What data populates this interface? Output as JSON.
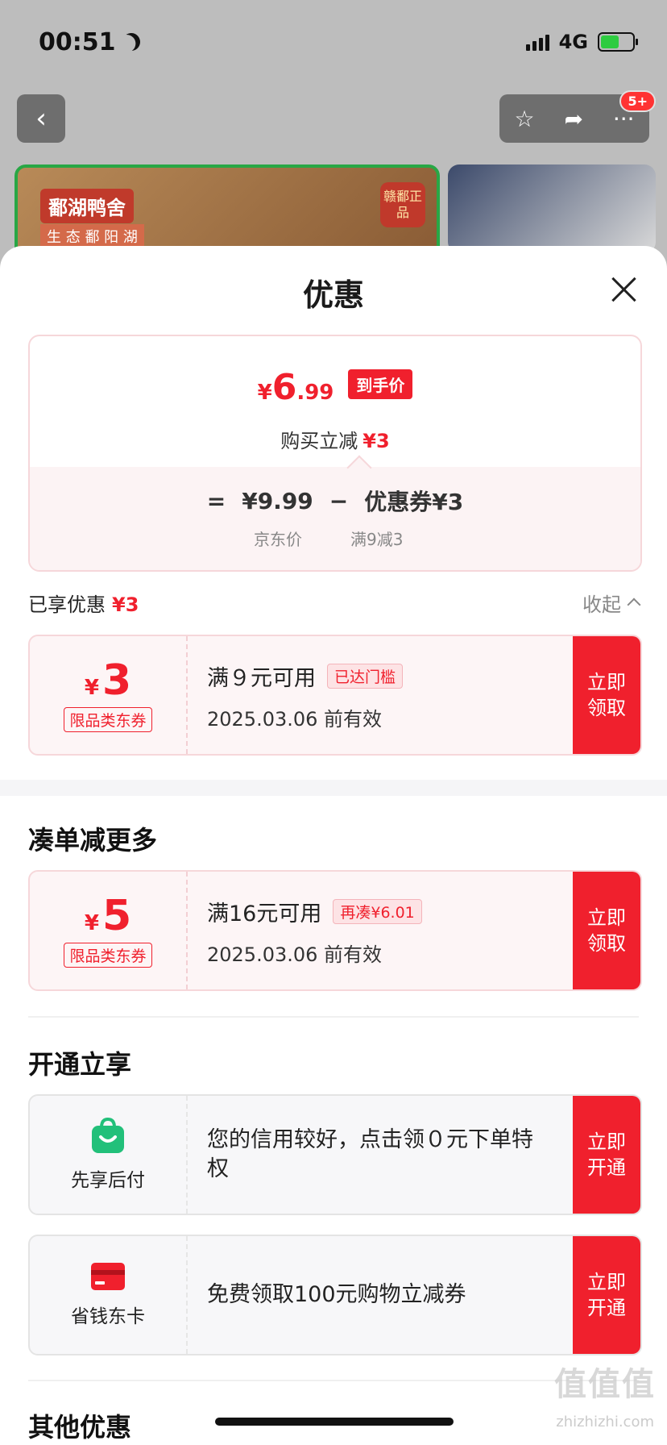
{
  "status": {
    "time": "00:51",
    "network": "4G"
  },
  "background": {
    "badge": "5+",
    "brand": "鄱湖鸭舍",
    "brand_sub": "生 态 鄱 阳 湖",
    "seal": "赣鄱正品"
  },
  "sheet": {
    "title": "优惠",
    "price_card": {
      "final_yen": "¥",
      "final_int": "6",
      "final_dec": ".99",
      "final_tag": "到手价",
      "reduce_label": "购买立减",
      "reduce_value": "¥3",
      "calc_eq": "=",
      "calc_price": "¥9.99",
      "calc_minus": "−",
      "calc_coupon": "优惠券¥3",
      "price_label": "京东价",
      "coupon_rule": "满9减3"
    },
    "enjoyed": {
      "label": "已享优惠",
      "value": "¥3",
      "collapse": "收起"
    },
    "coupons": [
      {
        "yen": "¥",
        "amount": "3",
        "type": "限品类东券",
        "condition": "满９元可用",
        "tag": "已达门槛",
        "date": "2025.03.06 前有效",
        "button": "立即\n领取"
      }
    ],
    "more_section_title": "凑单减更多",
    "more_coupons": [
      {
        "yen": "¥",
        "amount": "5",
        "type": "限品类东券",
        "condition": "满16元可用",
        "tag": "再凑¥6.01",
        "date": "2025.03.06 前有效",
        "button": "立即\n领取"
      }
    ],
    "open_section_title": "开通立享",
    "services": [
      {
        "icon": "shopping-bag-icon",
        "name": "先享后付",
        "text": "您的信用较好，点击领０元下单特权",
        "button": "立即\n开通",
        "color": "#22c07a"
      },
      {
        "icon": "card-icon",
        "name": "省钱东卡",
        "text": "免费领取100元购物立减券",
        "button": "立即\n开通",
        "color": "#f0202d"
      }
    ],
    "other_section_title": "其他优惠"
  },
  "watermark": {
    "main": "值值值",
    "sub": "zhizhizhi.com"
  },
  "colors": {
    "accent": "#f0202d",
    "green": "#22c07a"
  }
}
